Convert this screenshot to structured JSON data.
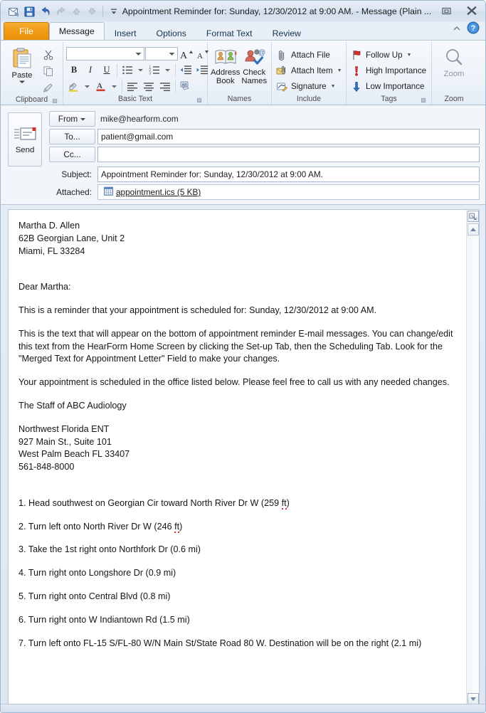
{
  "window": {
    "title": "Appointment Reminder for: Sunday, 12/30/2012 at 9:00 AM.  -  Message (Plain ...",
    "restore_label": "Restore",
    "close_label": "Close"
  },
  "quick_access": [
    {
      "name": "outlook-message-icon",
      "label": "Message"
    },
    {
      "name": "save-icon",
      "label": "Save"
    },
    {
      "name": "undo-icon",
      "label": "Undo"
    },
    {
      "name": "redo-icon",
      "label": "Redo"
    },
    {
      "name": "previous-item-icon",
      "label": "Previous Item"
    },
    {
      "name": "next-item-icon",
      "label": "Next Item"
    },
    {
      "name": "customize-qat-icon",
      "label": "Customize Quick Access Toolbar"
    }
  ],
  "tabs": [
    {
      "label": "File",
      "active": false,
      "kind": "file"
    },
    {
      "label": "Message",
      "active": true,
      "kind": "normal"
    },
    {
      "label": "Insert",
      "active": false,
      "kind": "normal"
    },
    {
      "label": "Options",
      "active": false,
      "kind": "normal"
    },
    {
      "label": "Format Text",
      "active": false,
      "kind": "normal"
    },
    {
      "label": "Review",
      "active": false,
      "kind": "normal"
    }
  ],
  "tabstrip_right": {
    "minimize_ribbon": "Minimize the Ribbon",
    "help": "Help"
  },
  "ribbon": {
    "clipboard": {
      "group_label": "Clipboard",
      "paste_label": "Paste",
      "cut_label": "Cut",
      "copy_label": "Copy",
      "format_painter_label": "Format Painter"
    },
    "basic_text": {
      "group_label": "Basic Text",
      "font_value": "",
      "font_placeholder": "",
      "size_value": "",
      "size_placeholder": "",
      "grow_font": "A",
      "shrink_font": "A",
      "bold": "B",
      "italic": "I",
      "underline": "U",
      "bullets": "Bullets",
      "numbering": "Numbering",
      "decrease_indent": "Decrease Indent",
      "increase_indent": "Increase Indent",
      "highlight": "Text Highlight Color",
      "font_color": "A",
      "align_left": "Align Text Left",
      "align_center": "Center",
      "align_right": "Align Text Right",
      "clear_formatting": "Clear Formatting"
    },
    "names": {
      "group_label": "Names",
      "address_book_line1": "Address",
      "address_book_line2": "Book",
      "check_names_line1": "Check",
      "check_names_line2": "Names"
    },
    "include": {
      "group_label": "Include",
      "items": [
        {
          "label": "Attach File",
          "icon": "paperclip-icon",
          "dropdown": false
        },
        {
          "label": "Attach Item",
          "icon": "attach-item-icon",
          "dropdown": true
        },
        {
          "label": "Signature",
          "icon": "signature-icon",
          "dropdown": true
        }
      ]
    },
    "tags": {
      "group_label": "Tags",
      "items": [
        {
          "label": "Follow Up",
          "icon": "flag-icon",
          "dropdown": true
        },
        {
          "label": "High Importance",
          "icon": "exclamation-icon",
          "dropdown": false
        },
        {
          "label": "Low Importance",
          "icon": "down-arrow-icon",
          "dropdown": false
        }
      ]
    },
    "zoom": {
      "group_label": "Zoom",
      "button_label": "Zoom"
    }
  },
  "compose": {
    "send_label": "Send",
    "from_button": "From",
    "from_value": "mike@hearform.com",
    "to_button": "To...",
    "to_value": "patient@gmail.com",
    "cc_button": "Cc...",
    "cc_value": "",
    "subject_label": "Subject:",
    "subject_value": "Appointment Reminder for: Sunday, 12/30/2012 at 9:00 AM.",
    "attached_label": "Attached:",
    "attachment_name": "appointment.ics (5 KB)",
    "attachment_icon": "calendar-file-icon"
  },
  "body": {
    "recipient_name": "Martha D. Allen",
    "recipient_street": "62B Georgian Lane, Unit 2",
    "recipient_city": "Miami, FL 33284",
    "salutation": "Dear Martha:",
    "para_reminder": "This is a reminder that your appointment is scheduled for: Sunday, 12/30/2012 at 9:00 AM.",
    "para_merged_text": "This is the text that will appear on the bottom of appointment reminder E-mail messages. You can change/edit this text from the HearForm Home Screen by clicking the Set-up Tab, then the Scheduling Tab. Look for the \"Merged Text for Appointment Letter\" Field to make your changes.",
    "para_office": "Your appointment is scheduled in the office listed below. Please feel free to call us with any needed changes.",
    "signoff": "The Staff of ABC Audiology",
    "office_name": "Northwest Florida ENT",
    "office_street": "927 Main St., Suite 101",
    "office_city": "West Palm Beach FL 33407",
    "office_phone": "561-848-8000",
    "directions": [
      {
        "num": "1.",
        "text_before": "Head southwest on Georgian Cir toward North River Dr W (259 ",
        "unit": "ft",
        "text_after": ")",
        "misspelled": true
      },
      {
        "num": "2.",
        "text_before": "Turn left onto North River Dr W (246 ",
        "unit": "ft",
        "text_after": ")",
        "misspelled": true
      },
      {
        "num": "3.",
        "text_before": "Take the 1st right onto Northfork Dr (0.6 mi)",
        "unit": "",
        "text_after": "",
        "misspelled": false
      },
      {
        "num": "4.",
        "text_before": "Turn right onto Longshore Dr (0.9 mi)",
        "unit": "",
        "text_after": "",
        "misspelled": false
      },
      {
        "num": "5.",
        "text_before": "Turn right onto Central Blvd (0.8 mi)",
        "unit": "",
        "text_after": "",
        "misspelled": false
      },
      {
        "num": "6.",
        "text_before": "Turn right onto W Indiantown Rd (1.5 mi)",
        "unit": "",
        "text_after": "",
        "misspelled": false
      },
      {
        "num": "7.",
        "text_before": "Turn left onto FL-15 S/FL-80 W/N Main St/State Road 80 W. Destination will be on the right (2.1 mi)",
        "unit": "",
        "text_after": "",
        "misspelled": false
      }
    ]
  },
  "colors": {
    "file_tab": "#f09a15",
    "accent_blue": "#2e6da4",
    "spell_error": "#d83030",
    "window_chrome": "#dde6f1",
    "high_importance": "#d2322d"
  }
}
